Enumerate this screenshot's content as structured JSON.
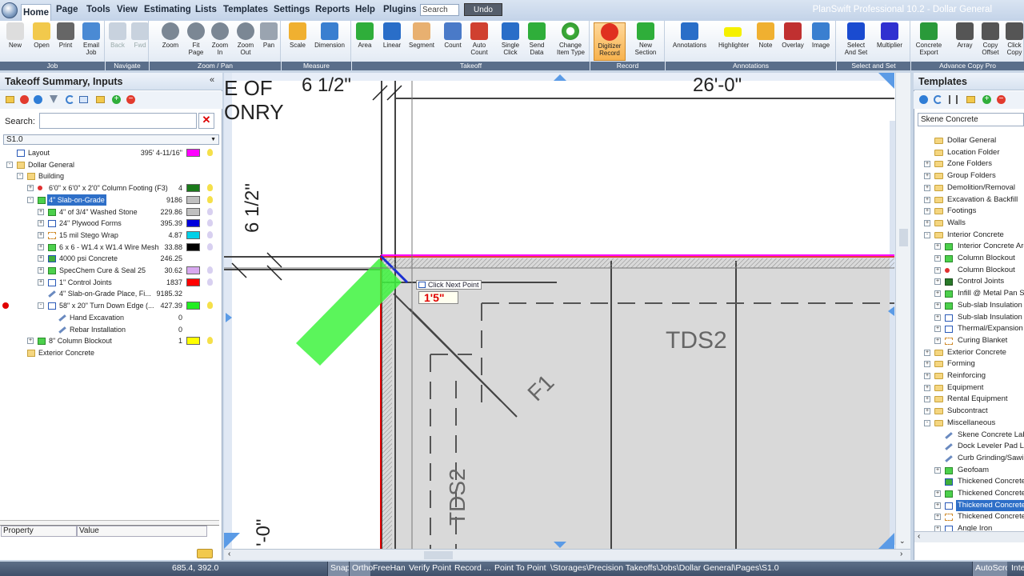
{
  "app": {
    "title": "PlanSwift Professional 10.2 - Dollar General"
  },
  "menu": [
    "Home",
    "Page",
    "Tools",
    "View",
    "Estimating",
    "Lists",
    "Templates",
    "Settings",
    "Reports",
    "Help",
    "Plugins"
  ],
  "search": {
    "value": "Search"
  },
  "undo_label": "Undo",
  "ribbon": {
    "groups": [
      "Job",
      "Navigate",
      "Zoom / Pan",
      "Measure",
      "Takeoff",
      "Record",
      "Annotations",
      "Select and Set",
      "Advance Copy Pro"
    ],
    "buttons": [
      {
        "label": "New",
        "icon": "new-doc-icon"
      },
      {
        "label": "Open",
        "icon": "folder-open-icon"
      },
      {
        "label": "Print",
        "icon": "printer-icon"
      },
      {
        "label": "Email\nJob",
        "icon": "email-icon"
      },
      {
        "label": "Back",
        "icon": "back-arrow-icon"
      },
      {
        "label": "Fwd",
        "icon": "forward-arrow-icon"
      },
      {
        "label": "Zoom",
        "icon": "zoom-icon"
      },
      {
        "label": "Fit\nPage",
        "icon": "fit-page-icon"
      },
      {
        "label": "Zoom\nIn",
        "icon": "zoom-in-icon"
      },
      {
        "label": "Zoom\nOut",
        "icon": "zoom-out-icon"
      },
      {
        "label": "Pan",
        "icon": "hand-icon"
      },
      {
        "label": "Scale",
        "icon": "scale-icon"
      },
      {
        "label": "Dimension",
        "icon": "dimension-icon"
      },
      {
        "label": "Area",
        "icon": "area-icon"
      },
      {
        "label": "Linear",
        "icon": "linear-icon"
      },
      {
        "label": "Segment",
        "icon": "segment-icon"
      },
      {
        "label": "Count",
        "icon": "count-icon"
      },
      {
        "label": "Auto\nCount",
        "icon": "auto-count-icon"
      },
      {
        "label": "Single\nClick",
        "icon": "single-click-icon"
      },
      {
        "label": "Send\nData",
        "icon": "send-data-icon"
      },
      {
        "label": "Change\nItem Type",
        "icon": "change-type-icon"
      },
      {
        "label": "Digitizer\nRecord",
        "icon": "record-icon"
      },
      {
        "label": "New\nSection",
        "icon": "new-section-icon"
      },
      {
        "label": "Annotations",
        "icon": "annotations-icon"
      },
      {
        "label": "Highlighter",
        "icon": "highlighter-icon"
      },
      {
        "label": "Note",
        "icon": "note-icon"
      },
      {
        "label": "Overlay",
        "icon": "overlay-icon"
      },
      {
        "label": "Image",
        "icon": "image-icon"
      },
      {
        "label": "Select\nAnd Set",
        "icon": "select-and-set-icon"
      },
      {
        "label": "Multiplier",
        "icon": "multiplier-icon"
      },
      {
        "label": "Concrete\nExport",
        "icon": "excel-icon"
      },
      {
        "label": "Array",
        "icon": "array-icon"
      },
      {
        "label": "Copy\nOffset",
        "icon": "copy-offset-icon"
      },
      {
        "label": "Click\nCopy",
        "icon": "click-copy-icon"
      }
    ]
  },
  "left_panel": {
    "title": "Takeoff Summary, Inputs",
    "search_label": "Search:",
    "page": "S1.0",
    "tree": [
      {
        "name": "Layout",
        "qty": "395' 4-11/16\"",
        "color": "#ff00ff",
        "bulb": "#f5e04a",
        "indent": 1,
        "icon": "linear"
      },
      {
        "name": "Dollar General",
        "qty": "",
        "color": "",
        "bulb": "",
        "indent": 1,
        "icon": "folder",
        "exp": "-"
      },
      {
        "name": "Building",
        "qty": "",
        "color": "",
        "bulb": "",
        "indent": 2,
        "icon": "folder",
        "exp": "-"
      },
      {
        "name": "6'0\" x 6'0\" x 2'0\" Column Footing (F3)",
        "qty": "4",
        "color": "#1a7a1a",
        "bulb": "#f5e04a",
        "indent": 3,
        "icon": "count",
        "exp": "+"
      },
      {
        "name": "4\" Slab-on-Grade",
        "qty": "9186",
        "color": "#c0c0c0",
        "bulb": "#f5e04a",
        "indent": 3,
        "icon": "area",
        "exp": "-",
        "sel": true
      },
      {
        "name": "4\" of 3/4\" Washed Stone",
        "qty": "229.86",
        "color": "#c0c0c0",
        "bulb": "#d8d0f0",
        "indent": 4,
        "icon": "area",
        "exp": "+"
      },
      {
        "name": "24\" Plywood Forms",
        "qty": "395.39",
        "color": "#0000dd",
        "bulb": "#d8d0f0",
        "indent": 4,
        "icon": "linear",
        "exp": "+"
      },
      {
        "name": "15 mil Stego Wrap",
        "qty": "4.87",
        "color": "#00d0e8",
        "bulb": "#d8d0f0",
        "indent": 4,
        "icon": "segment",
        "exp": "+"
      },
      {
        "name": "6 x 6 - W1.4 x W1.4 Wire Mesh",
        "qty": "33.88",
        "color": "#000000",
        "bulb": "#d8d0f0",
        "indent": 4,
        "icon": "area",
        "exp": "+"
      },
      {
        "name": "4000 psi Concrete",
        "qty": "246.25",
        "color": "",
        "bulb": "",
        "indent": 4,
        "icon": "cube",
        "exp": "+"
      },
      {
        "name": "SpecChem Cure & Seal 25",
        "qty": "30.62",
        "color": "#d8a8f0",
        "bulb": "#d8d0f0",
        "indent": 4,
        "icon": "area",
        "exp": "+"
      },
      {
        "name": "1\" Control Joints",
        "qty": "1837",
        "color": "#ff0000",
        "bulb": "#d8d0f0",
        "indent": 4,
        "icon": "linear",
        "exp": "+"
      },
      {
        "name": "4\" Slab-on-Grade Place, Fi...",
        "qty": "9185.32",
        "color": "",
        "bulb": "",
        "indent": 4,
        "icon": "pencil"
      },
      {
        "name": "58\" x 20\" Turn Down Edge (...",
        "qty": "427.39",
        "color": "#22ee22",
        "bulb": "#f5e04a",
        "indent": 4,
        "icon": "linear",
        "exp": "-",
        "dot": true
      },
      {
        "name": "Hand Excavation",
        "qty": "0",
        "color": "",
        "bulb": "",
        "indent": 5,
        "icon": "pencil"
      },
      {
        "name": "Rebar Installation",
        "qty": "0",
        "color": "",
        "bulb": "",
        "indent": 5,
        "icon": "pencil"
      },
      {
        "name": "8\" Column Blockout",
        "qty": "1",
        "color": "#ffff00",
        "bulb": "#f5e04a",
        "indent": 3,
        "icon": "area",
        "exp": "+"
      },
      {
        "name": "Exterior Concrete",
        "qty": "",
        "color": "",
        "bulb": "",
        "indent": 2,
        "icon": "folder"
      }
    ],
    "property_headers": [
      "Property",
      "Value"
    ]
  },
  "drawing": {
    "texts": [
      "E OF",
      "ONRY",
      "6 1/2\"",
      "26'-0\"",
      "6 1/2\"",
      "TDS2",
      "F1",
      "TDS2",
      "'-0\""
    ],
    "tooltip": "Click Next Point",
    "length_readout": "1'5\""
  },
  "right_panel": {
    "title": "Templates",
    "selected": "Skene Concrete",
    "tree": [
      {
        "name": "Dollar General",
        "indent": 1,
        "icon": "folder"
      },
      {
        "name": "Location Folder",
        "indent": 1,
        "icon": "folder"
      },
      {
        "name": "Zone Folders",
        "indent": 1,
        "icon": "folder",
        "exp": "+"
      },
      {
        "name": "Group Folders",
        "indent": 1,
        "icon": "folder",
        "exp": "+"
      },
      {
        "name": "Demolition/Removal",
        "indent": 1,
        "icon": "folder",
        "exp": "+"
      },
      {
        "name": "Excavation & Backfill",
        "indent": 1,
        "icon": "folder",
        "exp": "+"
      },
      {
        "name": "Footings",
        "indent": 1,
        "icon": "folder",
        "exp": "+"
      },
      {
        "name": "Walls",
        "indent": 1,
        "icon": "folder",
        "exp": "+"
      },
      {
        "name": "Interior Concrete",
        "indent": 1,
        "icon": "folder",
        "exp": "-"
      },
      {
        "name": "Interior Concrete Are",
        "indent": 2,
        "icon": "area",
        "exp": "+"
      },
      {
        "name": "Column Blockout",
        "indent": 2,
        "icon": "area",
        "exp": "+"
      },
      {
        "name": "Column Blockout",
        "indent": 2,
        "icon": "count",
        "exp": "+"
      },
      {
        "name": "Control Joints",
        "indent": 2,
        "icon": "grid",
        "exp": "+"
      },
      {
        "name": "Infill @ Metal Pan Sta",
        "indent": 2,
        "icon": "area",
        "exp": "+"
      },
      {
        "name": "Sub-slab Insulation",
        "indent": 2,
        "icon": "area",
        "exp": "+"
      },
      {
        "name": "Sub-slab Insulation",
        "indent": 2,
        "icon": "linear",
        "exp": "+"
      },
      {
        "name": "Thermal/Expansion",
        "indent": 2,
        "icon": "linear",
        "exp": "+"
      },
      {
        "name": "Curing Blanket",
        "indent": 2,
        "icon": "segment",
        "exp": "+"
      },
      {
        "name": "Exterior Concrete",
        "indent": 1,
        "icon": "folder",
        "exp": "+"
      },
      {
        "name": "Forming",
        "indent": 1,
        "icon": "folder",
        "exp": "+"
      },
      {
        "name": "Reinforcing",
        "indent": 1,
        "icon": "folder",
        "exp": "+"
      },
      {
        "name": "Equipment",
        "indent": 1,
        "icon": "folder",
        "exp": "+"
      },
      {
        "name": "Rental Equipment",
        "indent": 1,
        "icon": "folder",
        "exp": "+"
      },
      {
        "name": "Subcontract",
        "indent": 1,
        "icon": "folder",
        "exp": "+"
      },
      {
        "name": "Miscellaneous",
        "indent": 1,
        "icon": "folder",
        "exp": "-"
      },
      {
        "name": "Skene Concrete Labo",
        "indent": 2,
        "icon": "pencil"
      },
      {
        "name": "Dock Leveler Pad La",
        "indent": 2,
        "icon": "pencil"
      },
      {
        "name": "Curb Grinding/Sawin",
        "indent": 2,
        "icon": "pencil"
      },
      {
        "name": "Geofoam",
        "indent": 2,
        "icon": "area",
        "exp": "+"
      },
      {
        "name": "Thickened Concrete",
        "indent": 2,
        "icon": "cube"
      },
      {
        "name": "Thickened Concrete",
        "indent": 2,
        "icon": "area",
        "exp": "+"
      },
      {
        "name": "Thickened Concrete",
        "indent": 2,
        "icon": "linear",
        "exp": "+",
        "sel": true
      },
      {
        "name": "Thickened Concrete",
        "indent": 2,
        "icon": "segment",
        "exp": "+"
      },
      {
        "name": "Angle Iron",
        "indent": 2,
        "icon": "linear",
        "exp": "+"
      }
    ]
  },
  "status": {
    "coords": "685.4, 392.0",
    "toggles": [
      "Snap",
      "Ortho",
      "FreeHand",
      "Verify Point",
      "Record ...",
      "Point To Point"
    ],
    "path": "\\Storages\\Precision Takeoffs\\Jobs\\Dollar General\\Pages\\S1.0",
    "autoscroll": "AutoScroll",
    "last": "Inte"
  },
  "colors": {
    "accent": "#2e6fc8",
    "ribbon_group_label": "#5a6e8a",
    "status": "#4a5a74"
  }
}
